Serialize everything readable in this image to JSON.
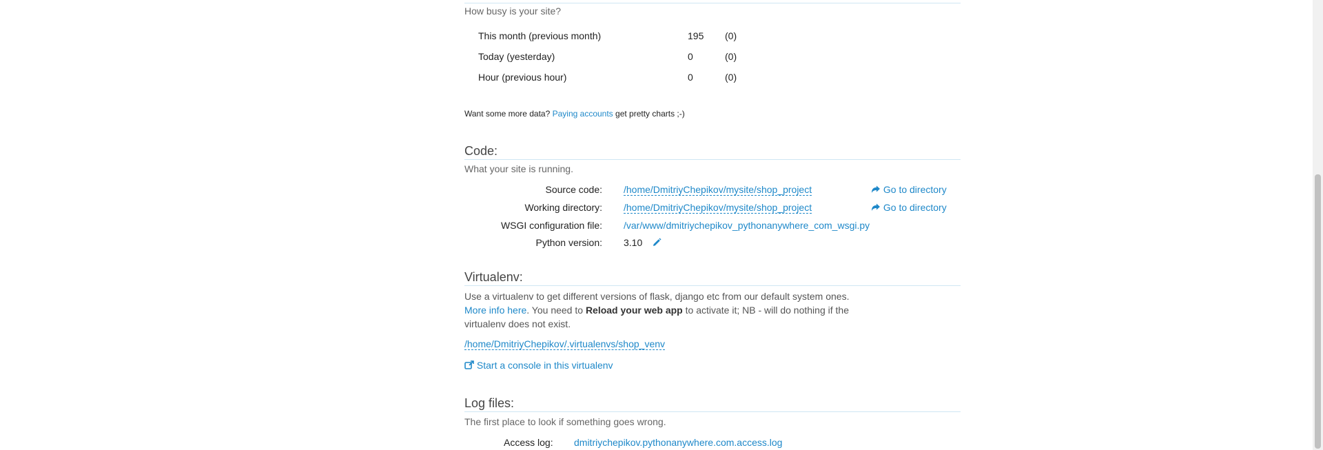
{
  "traffic": {
    "question": "How busy is your site?",
    "rows": [
      {
        "label": "This month (previous month)",
        "value": "195",
        "prev": "(0)"
      },
      {
        "label": "Today (yesterday)",
        "value": "0",
        "prev": "(0)"
      },
      {
        "label": "Hour (previous hour)",
        "value": "0",
        "prev": "(0)"
      }
    ],
    "more_data_prefix": "Want some more data?",
    "paying_accounts_link": "Paying accounts",
    "more_data_suffix": "get pretty charts ;-)"
  },
  "code": {
    "heading": "Code:",
    "subtitle": "What your site is running.",
    "source_label": "Source code:",
    "source_value": "/home/DmitriyChepikov/mysite/shop_project",
    "source_goto": "Go to directory",
    "working_label": "Working directory:",
    "working_value": "/home/DmitriyChepikov/mysite/shop_project",
    "working_goto": "Go to directory",
    "wsgi_label": "WSGI configuration file:",
    "wsgi_value": "/var/www/dmitriychepikov_pythonanywhere_com_wsgi.py",
    "python_label": "Python version:",
    "python_value": "3.10"
  },
  "virtualenv": {
    "heading": "Virtualenv:",
    "desc_part1": "Use a virtualenv to get different versions of flask, django etc from our default system ones.",
    "more_info_link": "More info here",
    "desc_part2": ". You need to",
    "reload_bold": "Reload your web app",
    "desc_part3": "to activate it; NB - will do nothing if the virtualenv does not exist.",
    "path": "/home/DmitriyChepikov/.virtualenvs/shop_venv",
    "console_link": "Start a console in this virtualenv"
  },
  "logs": {
    "heading": "Log files:",
    "subtitle": "The first place to look if something goes wrong.",
    "access_label": "Access log:",
    "access_value": "dmitriychepikov.pythonanywhere.com.access.log"
  },
  "colors": {
    "link": "#1e88c9",
    "rule": "#cfe6f3"
  },
  "icons": {
    "goto": "share-arrow-icon",
    "edit": "pencil-icon",
    "console": "external-link-icon"
  }
}
